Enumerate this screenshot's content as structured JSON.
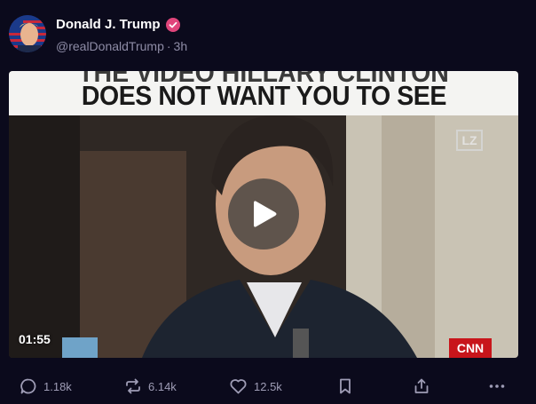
{
  "author": {
    "display_name": "Donald J. Trump",
    "handle": "@realDonaldTrump",
    "time_ago": "3h"
  },
  "media": {
    "caption_top": "THE VIDEO HILLARY CLINTON",
    "caption_main": "DOES NOT WANT YOU TO SEE",
    "watermark": "LZ",
    "channel_logo": "CNN",
    "duration": "01:55"
  },
  "actions": {
    "replies": "1.18k",
    "reposts": "6.14k",
    "likes": "12.5k"
  },
  "colors": {
    "background": "#0b0a1c",
    "muted_text": "#8e8ca6",
    "icon_gray": "#9e9cb5",
    "verified_badge": "#e0457b"
  },
  "icons": [
    "verified-badge-icon",
    "play-icon",
    "reply-icon",
    "repost-icon",
    "like-icon",
    "bookmark-icon",
    "share-icon",
    "more-icon"
  ]
}
